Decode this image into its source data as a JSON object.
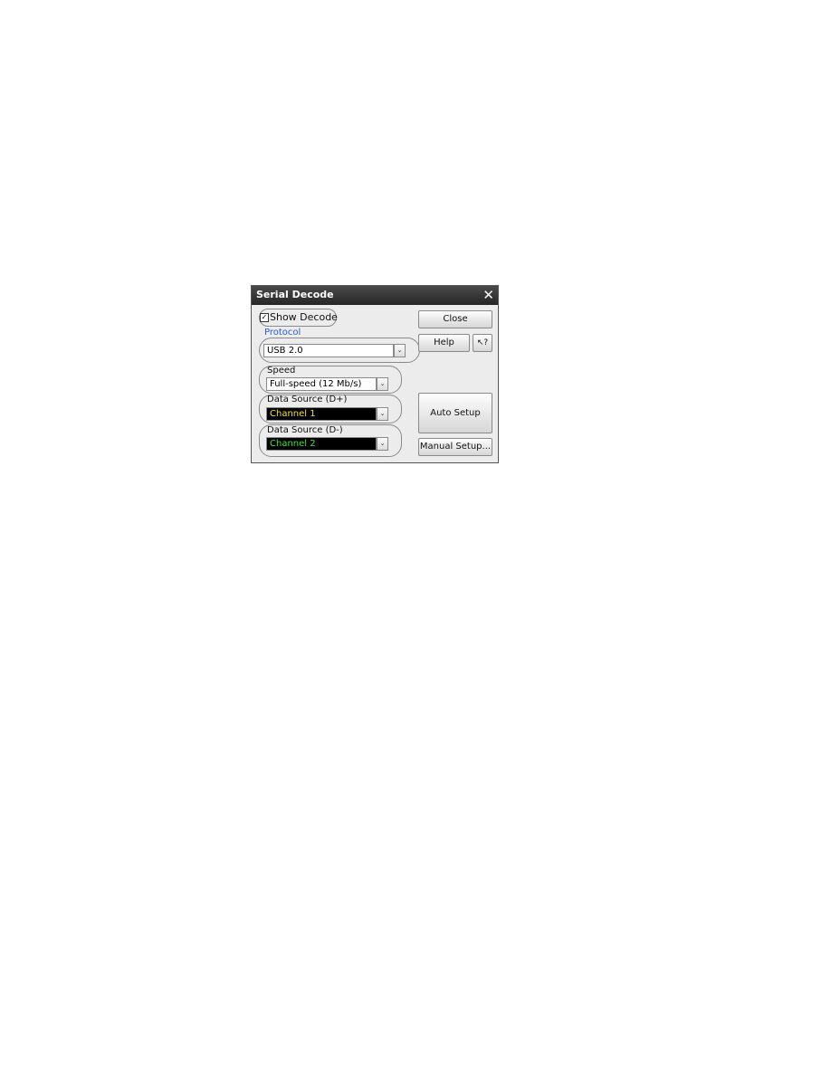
{
  "dialog": {
    "title": "Serial Decode",
    "close_icon": "close-x-icon",
    "show_decode": {
      "label": "Show Decode",
      "checked": true,
      "check_glyph": "☑"
    },
    "protocol": {
      "label": "Protocol",
      "value": "USB 2.0"
    },
    "speed": {
      "label": "Speed",
      "value": "Full-speed (12 Mb/s)"
    },
    "data_source_dplus": {
      "label": "Data Source (D+)",
      "value": "Channel 1",
      "color": "#f0e040"
    },
    "data_source_dminus": {
      "label": "Data Source (D-)",
      "value": "Channel 2",
      "color": "#40e040"
    },
    "dropdown_arrow": "⌄",
    "buttons": {
      "close": "Close",
      "help": "Help",
      "whats_this": "↖?",
      "auto_setup": "Auto Setup",
      "manual_setup": "Manual Setup..."
    }
  }
}
